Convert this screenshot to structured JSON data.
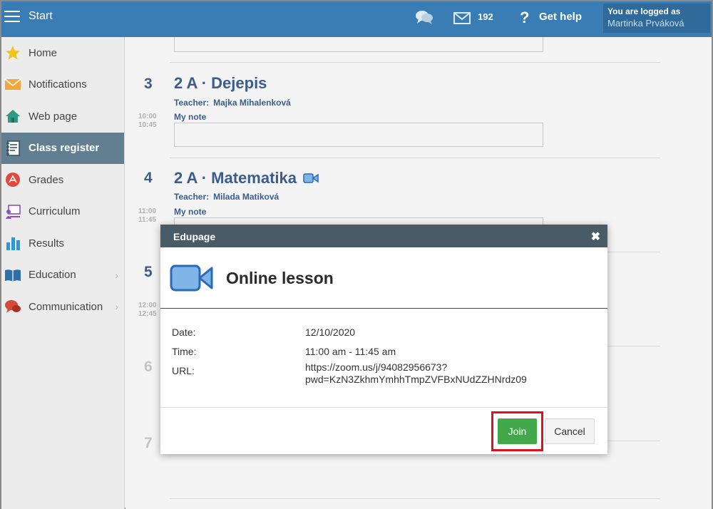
{
  "topbar": {
    "start_label": "Start",
    "mail_count": "192",
    "help_label": "Get help",
    "login_label": "You are logged as",
    "login_user": "Martinka Prváková"
  },
  "sidebar": {
    "items": [
      {
        "label": "Home",
        "icon": "star-icon",
        "active": false,
        "has_chevron": false
      },
      {
        "label": "Notifications",
        "icon": "envelope-icon",
        "active": false,
        "has_chevron": false
      },
      {
        "label": "Web page",
        "icon": "house-icon",
        "active": false,
        "has_chevron": false
      },
      {
        "label": "Class register",
        "icon": "notebook-icon",
        "active": true,
        "has_chevron": false
      },
      {
        "label": "Grades",
        "icon": "grades-icon",
        "active": false,
        "has_chevron": false
      },
      {
        "label": "Curriculum",
        "icon": "curriculum-icon",
        "active": false,
        "has_chevron": false
      },
      {
        "label": "Results",
        "icon": "bar-chart-icon",
        "active": false,
        "has_chevron": false
      },
      {
        "label": "Education",
        "icon": "open-book-icon",
        "active": false,
        "has_chevron": true
      },
      {
        "label": "Communication",
        "icon": "chat-bubbles-icon",
        "active": false,
        "has_chevron": true
      }
    ],
    "chevron_glyph": "›"
  },
  "timetable": {
    "periods": [
      {
        "num": "3",
        "time_start": "10:00",
        "time_end": "10:45",
        "title": "2 A · Dejepis",
        "teacher_label": "Teacher:",
        "teacher": "Majka Mihalenková",
        "note_label": "My note",
        "has_video": false
      },
      {
        "num": "4",
        "time_start": "11:00",
        "time_end": "11:45",
        "title": "2 A · Matematika",
        "teacher_label": "Teacher:",
        "teacher": "Milada Matiková",
        "note_label": "My note",
        "has_video": true
      },
      {
        "num": "5",
        "time_start": "12:00",
        "time_end": "12:45"
      },
      {
        "num": "6"
      },
      {
        "num": "7"
      }
    ]
  },
  "dialog": {
    "header": "Edupage",
    "close_glyph": "✖",
    "title": "Online lesson",
    "date_label": "Date:",
    "date_value": "12/10/2020",
    "time_label": "Time:",
    "time_value": "11:00 am - 11:45 am",
    "url_label": "URL:",
    "url_line1": "https://zoom.us/j/94082956673?",
    "url_line2": "pwd=KzN3ZkhmYmhhTmpZVFBxNUdZZHNrdz09",
    "join_label": "Join",
    "cancel_label": "Cancel"
  },
  "colors": {
    "topbar": "#3a7db4",
    "active_sidebar": "#617f91",
    "accent_text": "#3c5d8c",
    "join_button": "#43a84a",
    "highlight_outline": "#e0101f"
  }
}
